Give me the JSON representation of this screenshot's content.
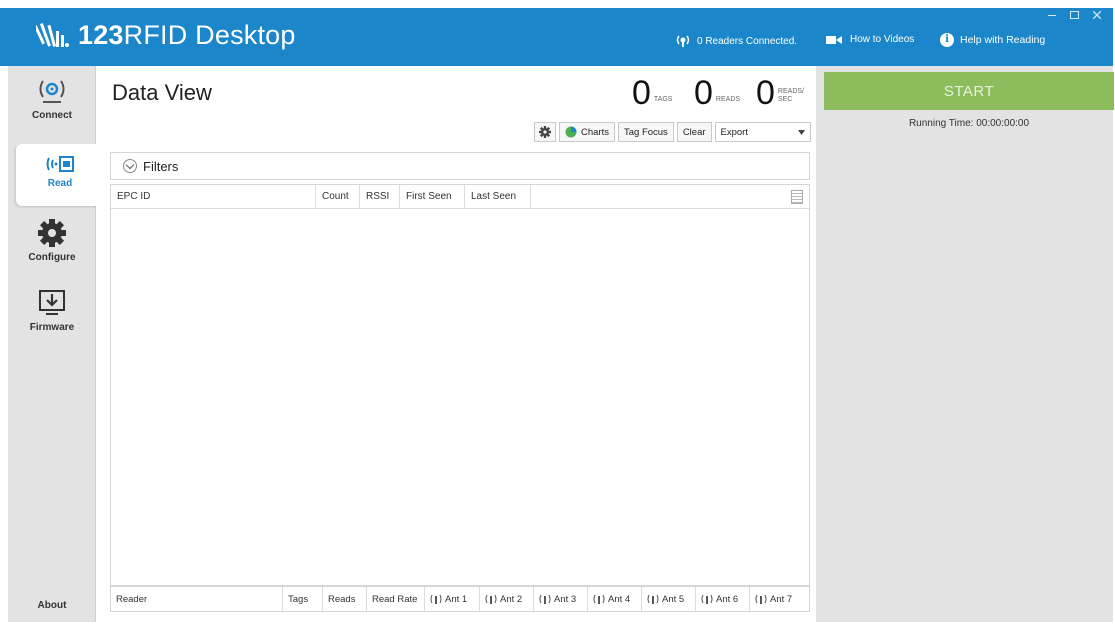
{
  "titlebar": {
    "app_name_bold": "123",
    "app_name_rest": "RFID Desktop",
    "readers_connected": "0 Readers Connected.",
    "how_to_videos": "How to Videos",
    "help_with_reading": "Help with Reading",
    "info_glyph": "i",
    "icons": [
      "zebra-logo-icon",
      "reader-signal-icon",
      "video-camera-icon",
      "info-icon"
    ],
    "color": "#1b86c9"
  },
  "nav": {
    "connect": "Connect",
    "read": "Read",
    "configure": "Configure",
    "firmware": "Firmware",
    "about": "About",
    "active": "Read"
  },
  "data_view": {
    "title": "Data View",
    "tags_count": "0",
    "tags_label": "TAGS",
    "reads_count": "0",
    "reads_label": "READS",
    "rate_count": "0",
    "rate_label_1": "READS/",
    "rate_label_2": "SEC"
  },
  "toolbar": {
    "charts": "Charts",
    "tag_focus": "Tag Focus",
    "clear": "Clear",
    "export": "Export"
  },
  "filters": {
    "label": "Filters"
  },
  "grid": {
    "columns": [
      "EPC ID",
      "Count",
      "RSSI",
      "First Seen",
      "Last Seen"
    ],
    "rows": []
  },
  "summary": {
    "columns": [
      "Reader",
      "Tags",
      "Reads",
      "Read Rate",
      "Ant 1",
      "Ant 2",
      "Ant 3",
      "Ant 4",
      "Ant 5",
      "Ant 6",
      "Ant 7"
    ]
  },
  "right": {
    "start": "START",
    "running_time": "Running Time: 00:00:00:00",
    "start_color": "#8dbc5d"
  }
}
